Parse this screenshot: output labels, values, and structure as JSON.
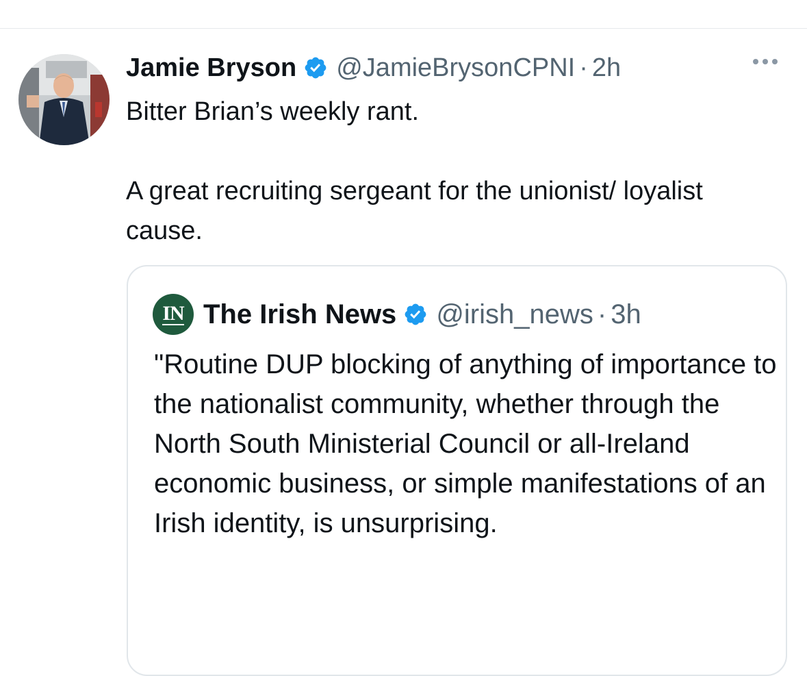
{
  "tweet": {
    "display_name": "Jamie Bryson",
    "handle": "@JamieBrysonCPNI",
    "separator": "·",
    "time": "2h",
    "text_line1": "Bitter Brian’s weekly rant.",
    "text_line2": "A great recruiting sergeant for the unionist/ loyalist cause.",
    "more_icon": "more-horizontal-icon",
    "verified_icon": "verified-badge-icon"
  },
  "quoted": {
    "logo_text": "IN",
    "display_name": "The Irish News",
    "handle": "@irish_news",
    "separator": "·",
    "time": "3h",
    "text": "\"Routine DUP blocking of anything of importance to the nationalist community, whether through the North South Ministerial Council or all-Ireland economic business, or simple manifestations of an Irish identity, is unsurprising."
  },
  "colors": {
    "text": "#0f1419",
    "secondary": "#536471",
    "verified": "#1d9bf0",
    "border": "#e1e6ea",
    "logo_bg": "#1f5a3d"
  }
}
